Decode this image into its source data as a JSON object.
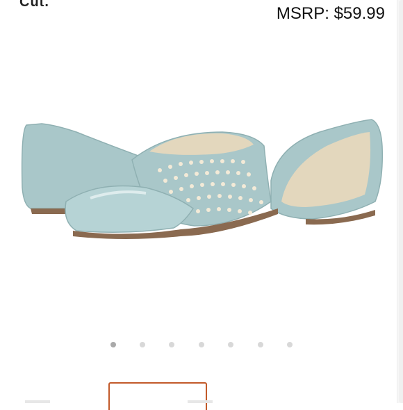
{
  "header": {
    "cut_title": "Cut.",
    "msrp": "MSRP: $59.99"
  },
  "product": {
    "image_icon": "shoe-product-image",
    "color": "#a9c7c9"
  },
  "carousel": {
    "total_dots": 7,
    "active_index": 0
  },
  "thumbnail": {
    "accent": "#c25a2a"
  }
}
